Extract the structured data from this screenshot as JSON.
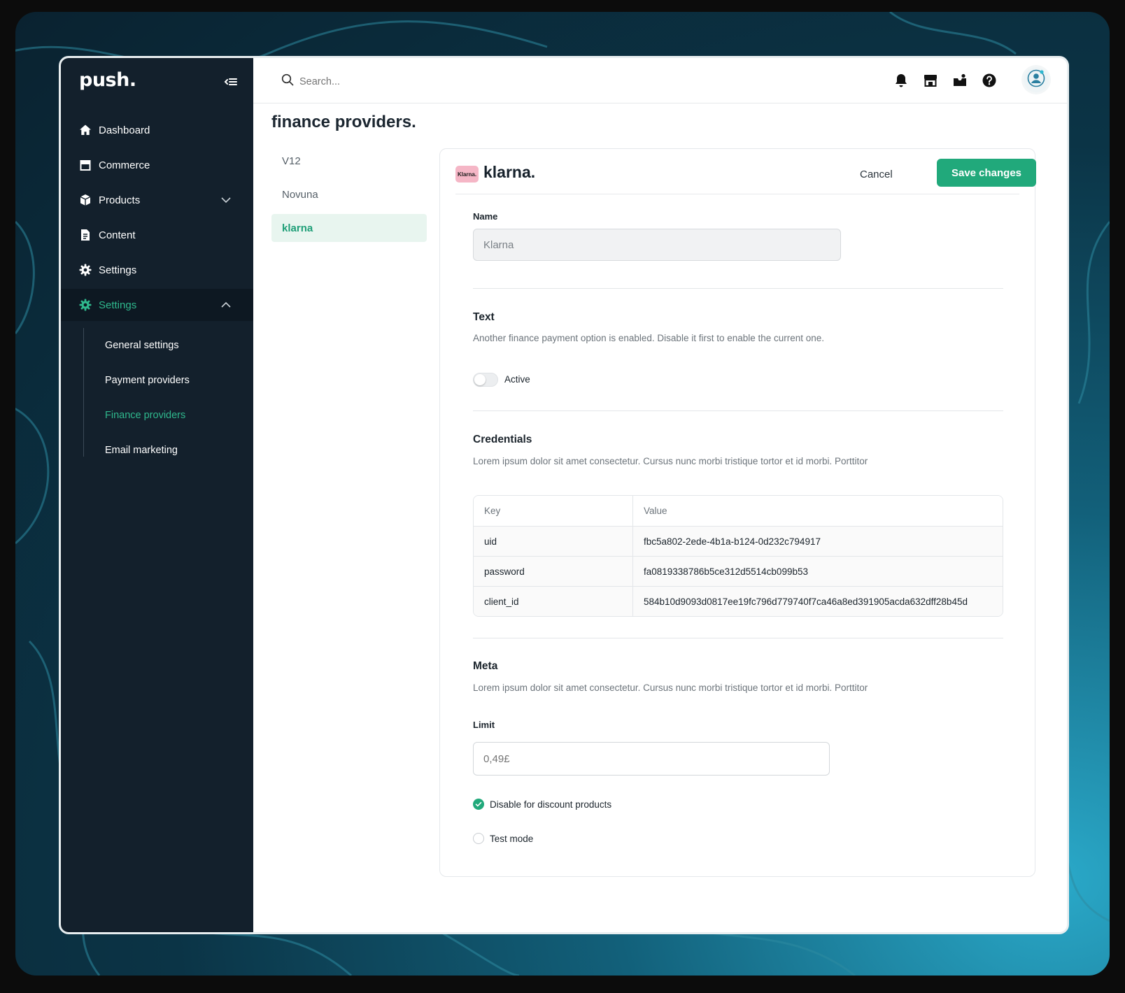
{
  "app": {
    "logo": "push.",
    "search_placeholder": "Search..."
  },
  "sidebar": {
    "items": [
      {
        "label": "Dashboard",
        "icon": "home-icon"
      },
      {
        "label": "Commerce",
        "icon": "store-icon"
      },
      {
        "label": "Products",
        "icon": "box-icon",
        "expandable": true
      },
      {
        "label": "Content",
        "icon": "document-icon"
      },
      {
        "label": "Settings",
        "icon": "gear-icon"
      },
      {
        "label": "Settings",
        "icon": "gear-icon",
        "active": true,
        "expanded": true
      }
    ],
    "subitems": [
      {
        "label": "General settings"
      },
      {
        "label": "Payment providers"
      },
      {
        "label": "Finance providers",
        "active": true
      },
      {
        "label": "Email marketing"
      }
    ]
  },
  "page": {
    "title": "finance providers."
  },
  "providers": [
    {
      "label": "V12"
    },
    {
      "label": "Novuna"
    },
    {
      "label": "klarna",
      "active": true
    }
  ],
  "card": {
    "badge_text": "Klarna.",
    "brand_word": "klarna.",
    "cancel_label": "Cancel",
    "save_label": "Save changes",
    "name_label": "Name",
    "name_value": "Klarna",
    "text_section": {
      "title": "Text",
      "description": "Another finance payment option is enabled. Disable it first to enable the current one.",
      "toggle_label": "Active",
      "toggle_on": false
    },
    "credentials": {
      "title": "Credentials",
      "description": "Lorem ipsum dolor sit amet consectetur. Cursus nunc morbi tristique tortor et id morbi. Porttitor",
      "headers": {
        "key": "Key",
        "value": "Value"
      },
      "rows": [
        {
          "key": "uid",
          "value": "fbc5a802-2ede-4b1a-b124-0d232c794917"
        },
        {
          "key": "password",
          "value": "fa0819338786b5ce312d5514cb099b53"
        },
        {
          "key": "client_id",
          "value": "584b10d9093d0817ee19fc796d779740f7ca46a8ed391905acda632dff28b45d"
        }
      ]
    },
    "meta": {
      "title": "Meta",
      "description": "Lorem ipsum dolor sit amet consectetur. Cursus nunc morbi tristique tortor et id morbi. Porttitor",
      "limit_label": "Limit",
      "limit_placeholder": "0,49£",
      "checkboxes": [
        {
          "label": "Disable for discount products",
          "checked": true
        },
        {
          "label": "Test mode",
          "checked": false
        }
      ]
    }
  },
  "colors": {
    "accent": "#21a97b",
    "sidebar_bg": "#13202c",
    "klarna_pink": "#f5b6c6"
  }
}
